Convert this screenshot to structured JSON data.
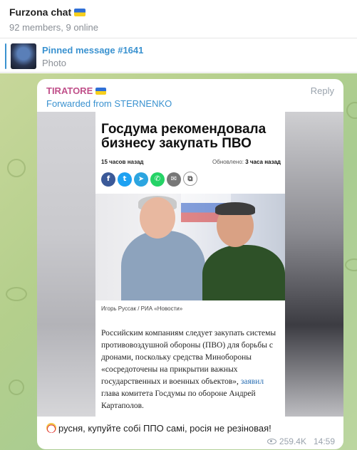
{
  "header": {
    "title": "Furzona chat",
    "subtitle": "92 members, 9 online"
  },
  "pinned": {
    "title": "Pinned message #1641",
    "subtitle": "Photo"
  },
  "message": {
    "author": "TIRATORE",
    "reply_label": "Reply",
    "forwarded": "Forwarded from STERNENKO",
    "text": "русня, купуйте собі ППО самі, росія не резіновая!",
    "views": "259.4K",
    "time": "14:59",
    "article": {
      "headline": "Госдума рекомендовала бизнесу закупать ПВО",
      "time_ago": "15 часов назад",
      "updated_label": "Обновлено:",
      "updated_value": "3 часа назад",
      "caption": "Игорь Руссак / РИА «Новости»",
      "body_before": "Российским компаниям следует закупать системы противовоздушной обороны (ПВО) для борьбы с дронами, поскольку средства Минобороны «сосредоточены на прикрытии важных государственных и военных объектов»,",
      "body_link": "заявил",
      "body_after": "глава комитета Госдумы по обороне Андрей Картаполов."
    }
  }
}
